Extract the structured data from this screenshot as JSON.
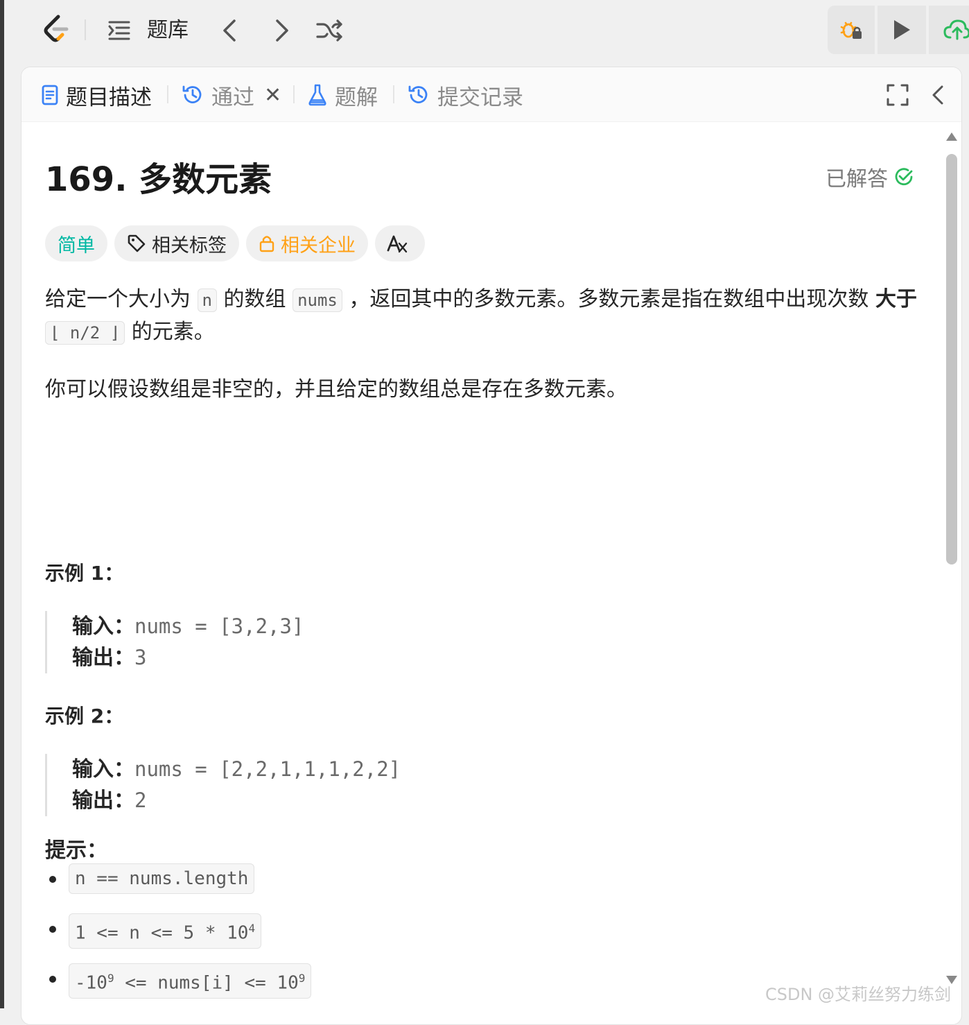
{
  "topnav": {
    "title": "题库"
  },
  "tabs": [
    {
      "label": "题目描述",
      "icon": "doc-icon"
    },
    {
      "label": "通过",
      "icon": "history-icon",
      "close": "✕"
    },
    {
      "label": "题解",
      "icon": "flask-icon"
    },
    {
      "label": "提交记录",
      "icon": "history-icon"
    }
  ],
  "problem": {
    "title": "169. 多数元素",
    "status": "已解答",
    "tags": [
      "简单",
      "相关标签",
      "相关企业"
    ],
    "desc1_a": "给定一个大小为 ",
    "desc1_code_n": "n",
    "desc1_b": " 的数组 ",
    "desc1_code_nums": "nums",
    "desc1_c": " ，返回其中的多数元素。多数元素是指在数组中出现次数 ",
    "desc1_bold": "大于",
    "desc1_code_half": "⌊ n/2 ⌋",
    "desc1_d": " 的元素。",
    "desc2": "你可以假设数组是非空的，并且给定的数组总是存在多数元素。"
  },
  "examples": [
    {
      "title": "示例 1：",
      "input_label": "输入：",
      "input": "nums = [3,2,3]",
      "output_label": "输出：",
      "output": "3"
    },
    {
      "title": "示例 2：",
      "input_label": "输入：",
      "input": "nums = [2,2,1,1,1,2,2]",
      "output_label": "输出：",
      "output": "2"
    }
  ],
  "hints": {
    "title": "提示：",
    "h1": "n == nums.length",
    "h2_base": "1 <= n <= 5 * 10",
    "h2_exp": "4",
    "h3_a": "-10",
    "h3_exp1": "9",
    "h3_b": " <= nums[i] <= 10",
    "h3_exp2": "9"
  },
  "watermark": "CSDN @艾莉丝努力练剑",
  "colors": {
    "easy": "#00b8a3",
    "company": "#ffa116",
    "solved": "#2cbb5d",
    "tab_icon_blue": "#3b82f6"
  }
}
